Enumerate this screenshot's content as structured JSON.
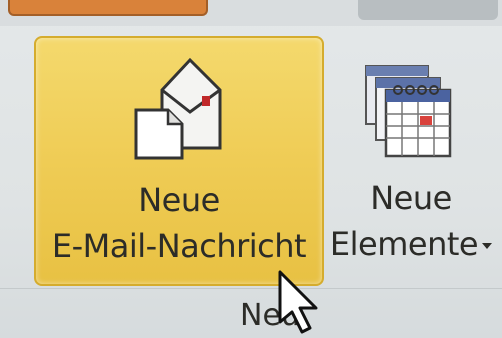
{
  "ribbon": {
    "new_mail": {
      "line1": "Neue",
      "line2": "E-Mail-Nachricht"
    },
    "new_items": {
      "line1": "Neue",
      "line2": "Elemente"
    },
    "group_label": "Neu"
  },
  "colors": {
    "highlight": "#efcc55",
    "text": "#2c2c28",
    "accent_orange": "#d9823a"
  }
}
